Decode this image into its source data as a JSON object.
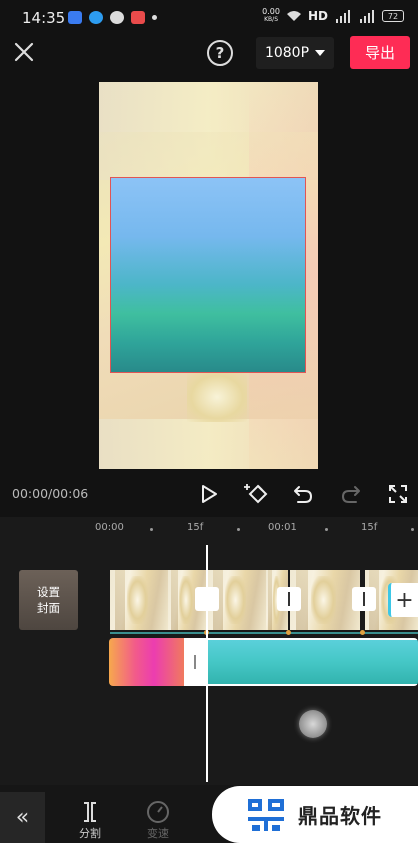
{
  "status_bar": {
    "time": "14:35",
    "net_speed": "0.00",
    "net_unit": "KB/S",
    "hd_label": "HD",
    "signal_1": "4G",
    "signal_2": "4G",
    "battery": "72"
  },
  "topbar": {
    "resolution": "1080P",
    "export_label": "导出",
    "help_symbol": "?"
  },
  "playback": {
    "time": "00:00/00:06"
  },
  "ruler": {
    "labels": [
      "00:00",
      "15f",
      "00:01",
      "15f"
    ]
  },
  "timeline": {
    "cover_label_line1": "设置",
    "cover_label_line2": "封面",
    "add_symbol": "+"
  },
  "toolbar": {
    "back_symbol": "«",
    "split_label": "分割",
    "speed_label": "变速"
  },
  "watermark": {
    "text": "鼎品软件"
  },
  "colors": {
    "accent": "#fe2c55",
    "background": "#121212"
  }
}
